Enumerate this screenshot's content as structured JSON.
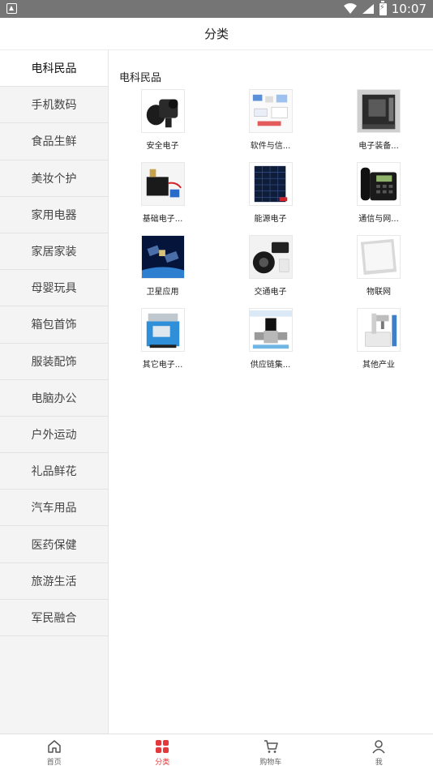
{
  "status_bar": {
    "time": "10:07"
  },
  "header": {
    "title": "分类"
  },
  "sidebar": {
    "items": [
      {
        "label": "电科民品",
        "active": true
      },
      {
        "label": "手机数码"
      },
      {
        "label": "食品生鲜"
      },
      {
        "label": "美妆个护"
      },
      {
        "label": "家用电器"
      },
      {
        "label": "家居家装"
      },
      {
        "label": "母婴玩具"
      },
      {
        "label": "箱包首饰"
      },
      {
        "label": "服装配饰"
      },
      {
        "label": "电脑办公"
      },
      {
        "label": "户外运动"
      },
      {
        "label": "礼品鲜花"
      },
      {
        "label": "汽车用品"
      },
      {
        "label": "医药保健"
      },
      {
        "label": "旅游生活"
      },
      {
        "label": "军民融合"
      }
    ]
  },
  "main": {
    "section_title": "电科民品",
    "items": [
      {
        "label": "安全电子",
        "icon": "security-camera-image"
      },
      {
        "label": "软件与信...",
        "icon": "software-diagram-image"
      },
      {
        "label": "电子装备...",
        "icon": "equipment-machine-image"
      },
      {
        "label": "基础电子...",
        "icon": "electronic-module-image"
      },
      {
        "label": "能源电子",
        "icon": "solar-panel-image"
      },
      {
        "label": "通信与网...",
        "icon": "telephone-image"
      },
      {
        "label": "卫星应用",
        "icon": "satellite-image"
      },
      {
        "label": "交通电子",
        "icon": "dashcam-image"
      },
      {
        "label": "物联网",
        "icon": "led-panel-image"
      },
      {
        "label": "其它电子...",
        "icon": "blue-device-image"
      },
      {
        "label": "供应链集...",
        "icon": "valve-image"
      },
      {
        "label": "其他产业",
        "icon": "laser-machine-image"
      }
    ]
  },
  "tabbar": {
    "items": [
      {
        "label": "首页",
        "icon": "home-icon"
      },
      {
        "label": "分类",
        "icon": "category-icon",
        "active": true
      },
      {
        "label": "购物车",
        "icon": "cart-icon"
      },
      {
        "label": "我",
        "icon": "user-icon"
      }
    ]
  },
  "colors": {
    "accent": "#e4393c",
    "sidebar_bg": "#f4f4f4",
    "statusbar_bg": "#757575"
  }
}
